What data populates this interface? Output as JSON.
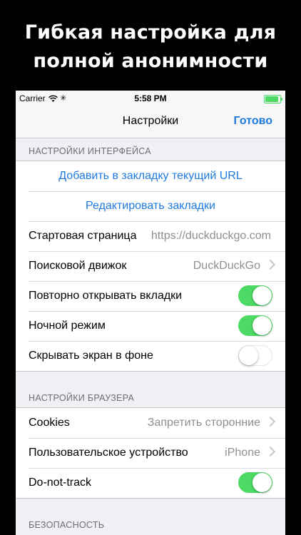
{
  "headline": {
    "line1": "Гибкая настройка для",
    "line2": "полной анонимности"
  },
  "status_bar": {
    "carrier": "Carrier",
    "time": "5:58 PM",
    "battery_level": 0.9
  },
  "nav": {
    "title": "Настройки",
    "done_label": "Готово"
  },
  "interface_section": {
    "header": "НАСТРОЙКИ ИНТЕРФЕЙСА",
    "add_bookmark": "Добавить в закладку текущий URL",
    "edit_bookmarks": "Редактировать закладки",
    "home_page_label": "Стартовая страница",
    "home_page_value": "https://duckduckgo.com",
    "search_engine_label": "Поисковой движок",
    "search_engine_value": "DuckDuckGo",
    "reopen_tabs_label": "Повторно открывать вкладки",
    "reopen_tabs_on": true,
    "night_mode_label": "Ночной режим",
    "night_mode_on": true,
    "hide_screen_label": "Скрывать экран в фоне",
    "hide_screen_on": false
  },
  "browser_section": {
    "header": "НАСТРОЙКИ БРАУЗЕРА",
    "cookies_label": "Cookies",
    "cookies_value": "Запретить сторонние",
    "user_agent_label": "Пользовательское устройство",
    "user_agent_value": "iPhone",
    "dnt_label": "Do-not-track",
    "dnt_on": true
  },
  "security_section": {
    "header": "БЕЗОПАСНОСТЬ"
  },
  "colors": {
    "accent": "#1f7ae0",
    "toggle_on": "#4cd964",
    "background": "#efeff4"
  }
}
